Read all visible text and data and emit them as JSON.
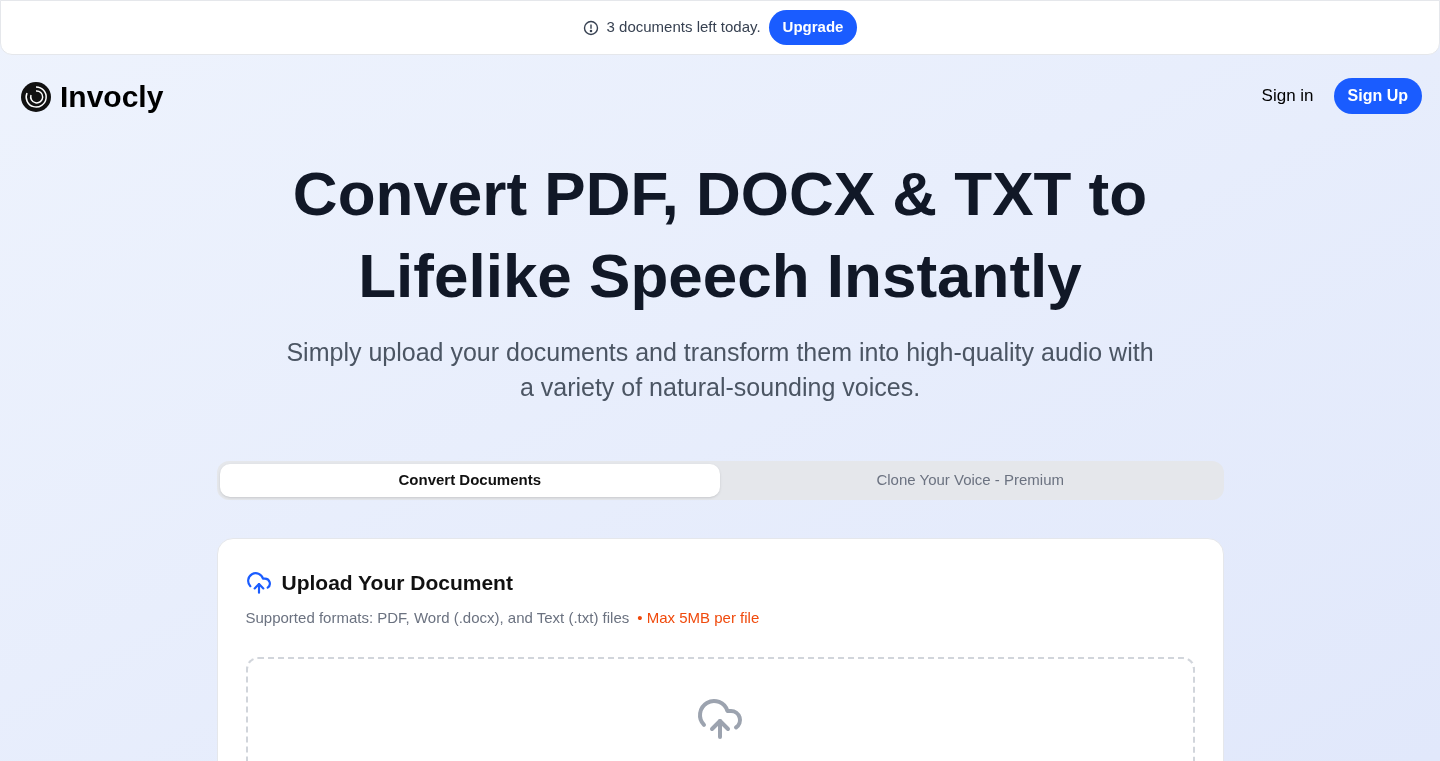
{
  "banner": {
    "text": "3 documents left today.",
    "button": "Upgrade"
  },
  "header": {
    "brand": "Invocly",
    "sign_in": "Sign in",
    "sign_up": "Sign Up"
  },
  "hero": {
    "title_lines": [
      "Convert PDF, DOCX & TXT to",
      "Lifelike Speech Instantly"
    ],
    "subtitle": "Simply upload your documents and transform them into high-quality audio with a variety of natural-sounding voices."
  },
  "tabs": [
    {
      "label": "Convert Documents",
      "selected": true
    },
    {
      "label": "Clone Your Voice - Premium",
      "selected": false
    }
  ],
  "upload": {
    "title": "Upload Your Document",
    "formats": "Supported formats: PDF, Word (.docx), and Text (.txt) files",
    "limit": "• Max 5MB per file"
  }
}
